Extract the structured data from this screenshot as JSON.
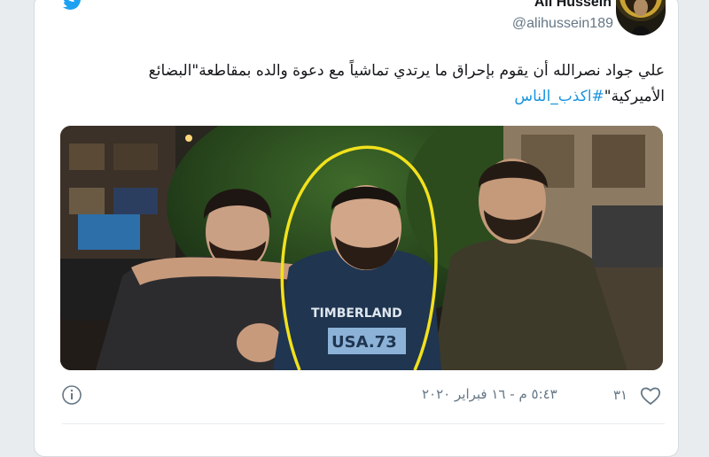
{
  "tweet": {
    "display_name": "Ali Hussein",
    "handle": "@alihussein189",
    "text_line1": "علي جواد نصرالله أن يقوم بإحراق ما يرتدي  تماشياً مع دعوة والده بمقاطعة\"البضائع",
    "text_line2_prefix": "الأميركية\"",
    "hashtag": "#اكذب_الناس",
    "likes": "٣١",
    "timestamp": "٥:٤٣ م - ١٦ فبراير ٢٠٢٠"
  },
  "photo": {
    "sweatshirt_brand": "TIMBERLAND",
    "sweatshirt_text": "USA.73"
  },
  "colors": {
    "twitter_blue": "#1da1f2",
    "link_blue": "#1b95e0",
    "text": "#14171a",
    "secondary": "#657786",
    "highlight_circle": "#f2e11c"
  },
  "icons": [
    "twitter-logo-icon",
    "info-icon",
    "heart-icon"
  ]
}
